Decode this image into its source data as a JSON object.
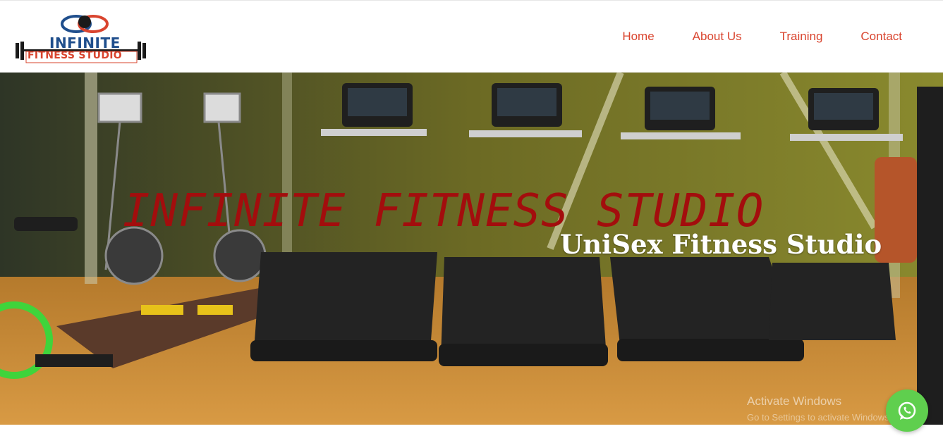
{
  "brand": {
    "logo_line_1": "INFINITE",
    "logo_line_2": "FITNESS STUDIO"
  },
  "nav": {
    "items": [
      {
        "label": "Home"
      },
      {
        "label": "About Us"
      },
      {
        "label": "Training"
      },
      {
        "label": "Contact"
      }
    ]
  },
  "hero": {
    "title": "INFINITE FITNESS STUDIO",
    "subtitle": "UniSex Fitness Studio",
    "image": "gym-treadmills-photo"
  },
  "watermark": {
    "line_1": "Activate Windows",
    "line_2": "Go to Settings to activate Windows."
  },
  "floating": {
    "icon": "whatsapp-icon"
  },
  "colors": {
    "accent": "#d9442e",
    "title_red": "#a30d0d",
    "whatsapp": "#5fcf4e"
  }
}
